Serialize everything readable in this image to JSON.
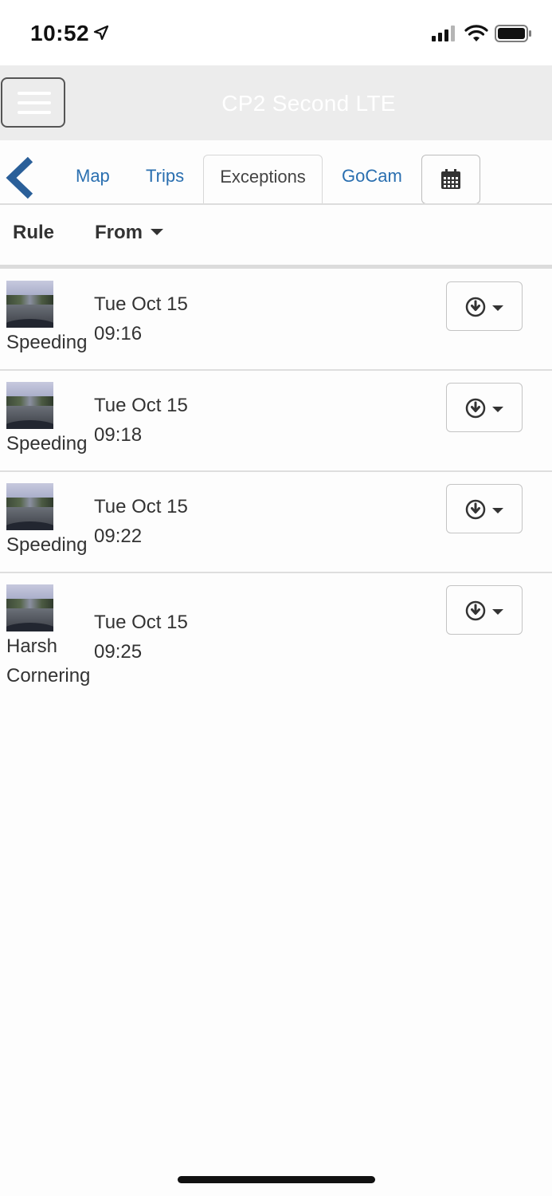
{
  "status_bar": {
    "time": "10:52",
    "icons": [
      "location-arrow-icon",
      "cellular-signal-icon",
      "wifi-icon",
      "battery-icon"
    ]
  },
  "header": {
    "title": "CP2 Second LTE",
    "menu_icon": "hamburger-menu-icon"
  },
  "tabs": {
    "back_icon": "chevron-left-icon",
    "items": [
      {
        "label": "Map",
        "active": false
      },
      {
        "label": "Trips",
        "active": false
      },
      {
        "label": "Exceptions",
        "active": true
      },
      {
        "label": "GoCam",
        "active": false
      }
    ],
    "calendar_icon": "calendar-icon"
  },
  "columns": {
    "rule": "Rule",
    "from": "From"
  },
  "rows": [
    {
      "rule_line1": "Speeding",
      "rule_line2": "",
      "date": "Tue Oct 15",
      "time": "09:16",
      "action_icon": "download-circle-icon"
    },
    {
      "rule_line1": "Speeding",
      "rule_line2": "",
      "date": "Tue Oct 15",
      "time": "09:18",
      "action_icon": "download-circle-icon"
    },
    {
      "rule_line1": "Speeding",
      "rule_line2": "",
      "date": "Tue Oct 15",
      "time": "09:22",
      "action_icon": "download-circle-icon"
    },
    {
      "rule_line1": "Harsh",
      "rule_line2": "Cornering",
      "date": "Tue Oct 15",
      "time": "09:25",
      "action_icon": "download-circle-icon"
    }
  ],
  "colors": {
    "header_bg": "#ececec",
    "tab_link": "#2a6fb0",
    "chevron": "#2a5f99",
    "text": "#333333"
  }
}
